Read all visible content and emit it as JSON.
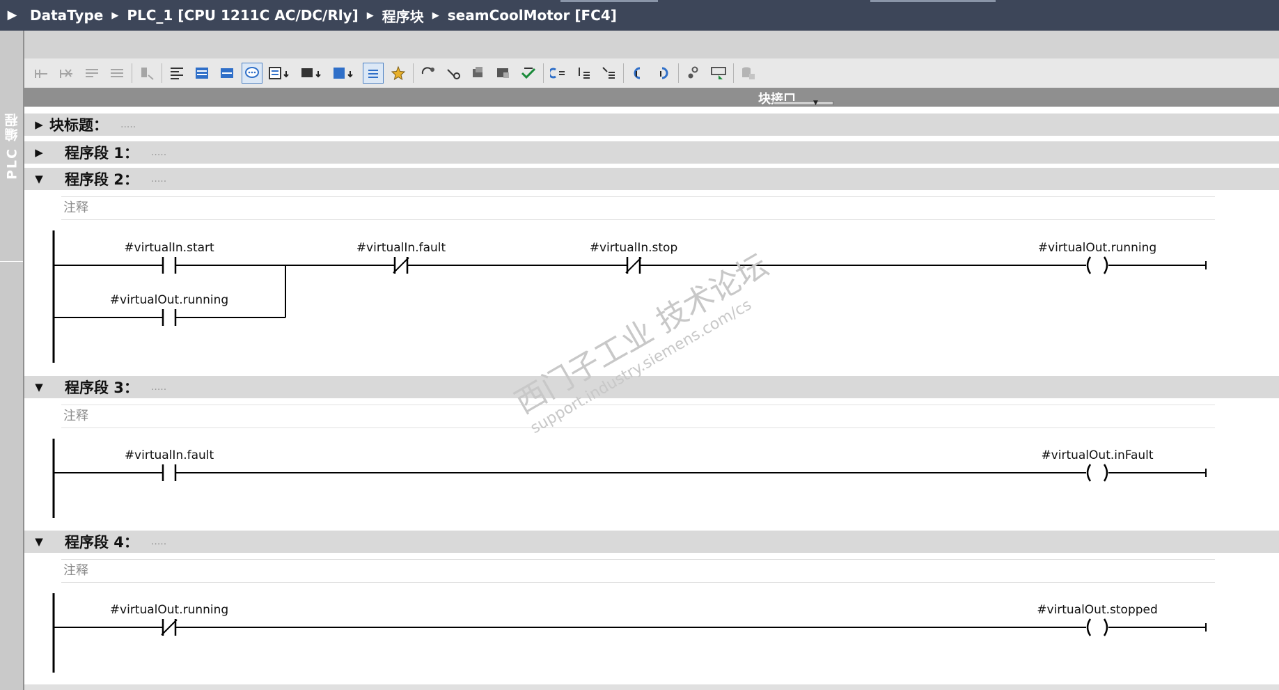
{
  "left_panel": {
    "label": "PLC 编程"
  },
  "breadcrumb": {
    "items": [
      "DataType",
      "PLC_1 [CPU 1211C AC/DC/Rly]",
      "程序块",
      "seamCoolMotor [FC4]"
    ]
  },
  "interface_bar": {
    "label": "块接口"
  },
  "block_title": {
    "label": "块标题：",
    "dots": "....."
  },
  "networks": [
    {
      "title": "程序段 1：",
      "dots": "....."
    },
    {
      "title": "程序段 2：",
      "dots": ".....",
      "comment": "注释",
      "contact_start": "#virtualIn.start",
      "contact_running": "#virtualOut.running",
      "contact_fault": "#virtualIn.fault",
      "contact_stop": "#virtualIn.stop",
      "coil": "#virtualOut.running"
    },
    {
      "title": "程序段 3：",
      "dots": ".....",
      "comment": "注释",
      "contact_fault": "#virtualIn.fault",
      "coil": "#virtualOut.inFault"
    },
    {
      "title": "程序段 4：",
      "dots": ".....",
      "comment": "注释",
      "contact_running": "#virtualOut.running",
      "coil": "#virtualOut.stopped"
    }
  ],
  "watermark": {
    "line1": "西门子工业 技术论坛",
    "line2": "support.industry.siemens.com/cs"
  }
}
